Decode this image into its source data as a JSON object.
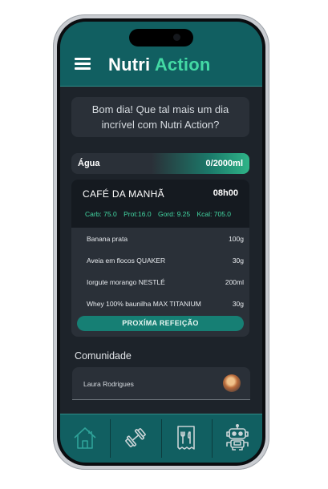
{
  "app": {
    "brand_part1": "Nutri",
    "brand_part2": "Action"
  },
  "greeting": "Bom dia! Que tal mais um dia incrível com Nutri Action?",
  "water": {
    "label": "Água",
    "value": "0/2000ml"
  },
  "meal": {
    "title": "CAFÉ DA MANHÃ",
    "time": "08h00",
    "macros": [
      "Carb: 75.0",
      "Prot:16.0",
      "Gord: 9.25",
      "Kcal: 705.0"
    ],
    "items": [
      {
        "name": "Banana prata",
        "amount": "100g"
      },
      {
        "name": "Aveia em flocos QUAKER",
        "amount": "30g"
      },
      {
        "name": "Iorgute morango NESTLÉ",
        "amount": "200ml"
      },
      {
        "name": "Whey 100% baunilha MAX TITANIUM",
        "amount": "30g"
      }
    ],
    "next_button": "PROXÍMA REFEIÇÃO"
  },
  "community": {
    "title": "Comunidade",
    "posts": [
      {
        "author": "Laura Rodrigues"
      }
    ]
  },
  "tabbar": {
    "items": [
      "home-icon",
      "dumbbell-icon",
      "meal-plan-icon",
      "robot-icon"
    ]
  },
  "colors": {
    "primary": "#115f61",
    "accent": "#43d9a4",
    "background": "#1d232a",
    "card": "#2a3038",
    "button": "#167f74"
  }
}
